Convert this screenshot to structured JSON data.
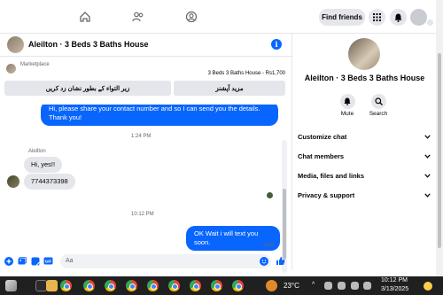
{
  "topbar": {
    "find_friends": "Find friends"
  },
  "chat": {
    "title": "Aleilton · 3 Beds 3 Baths House",
    "marketplace_label": "Marketplace",
    "listing": "3 Beds 3 Baths House - Rs1,700",
    "btn_mark_pending": "زیر التواء کے بطور نشان زد کریں",
    "btn_more_options": "مزید آپشنز",
    "messages": {
      "out1": "Hi, please share your contact number and so I can send you the details. Thank you!",
      "ts1": "1:24 PM",
      "sender": "Aleilton",
      "in1": "Hi, yes!!",
      "in2": "7744373398",
      "ts2": "10:12 PM",
      "out2": "OK Wait i will text you soon.",
      "status": "Sent"
    },
    "composer_placeholder": "Aa"
  },
  "details": {
    "title": "Aleilton · 3 Beds 3 Baths House",
    "mute": "Mute",
    "search": "Search",
    "sections": [
      "Customize chat",
      "Chat members",
      "Media, files and links",
      "Privacy & support"
    ]
  },
  "taskbar": {
    "temperature": "23°C",
    "time": "10:12 PM",
    "date": "3/13/2025"
  }
}
